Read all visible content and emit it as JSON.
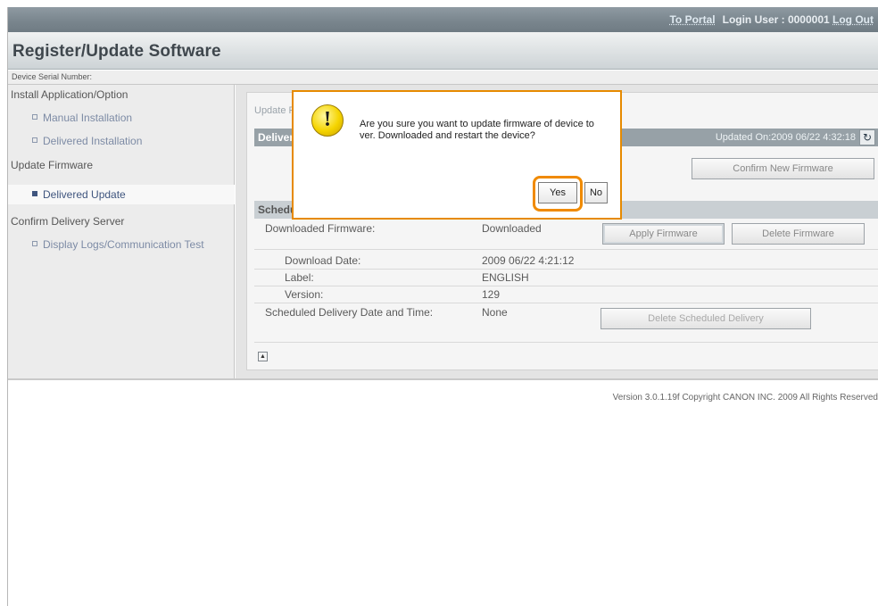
{
  "topbar": {
    "to_portal": "To Portal",
    "login_user": "Login User : 0000001",
    "log_out": "Log Out"
  },
  "title": "Register/Update Software",
  "device_serial_label": "Device Serial Number:",
  "sidebar": {
    "install_heading": "Install Application/Option",
    "manual_installation": "Manual Installation",
    "delivered_installation": "Delivered Installation",
    "update_heading": "Update Firmware",
    "delivered_update": "Delivered Update",
    "confirm_heading": "Confirm Delivery Server",
    "display_logs": "Display Logs/Communication Test"
  },
  "content": {
    "breadcrumb": "Update Firmware",
    "delivered_heading": "Delivered Update",
    "updated_on": "Updated On:2009 06/22 4:32:18",
    "confirm_new_firmware": "Confirm New Firmware",
    "scheduled_heading": "Scheduled Update",
    "downloaded_firmware_label": "Downloaded Firmware:",
    "downloaded_firmware_value": "Downloaded",
    "apply_firmware": "Apply Firmware",
    "delete_firmware": "Delete Firmware",
    "download_date_label": "Download Date:",
    "download_date_value": "2009 06/22 4:21:12",
    "label_label": "Label:",
    "label_value": "ENGLISH",
    "version_label": "Version:",
    "version_value": "129",
    "scheduled_delivery_label": "Scheduled Delivery Date and Time:",
    "scheduled_delivery_value": "None",
    "delete_scheduled_delivery": "Delete Scheduled Delivery"
  },
  "footer": "Version 3.0.1.19f Copyright CANON INC. 2009 All Rights Reserved",
  "dialog": {
    "message": "Are you sure you want to update firmware of device to ver. Downloaded and restart the device?",
    "yes": "Yes",
    "no": "No",
    "highlight_color": "#f08a00"
  }
}
